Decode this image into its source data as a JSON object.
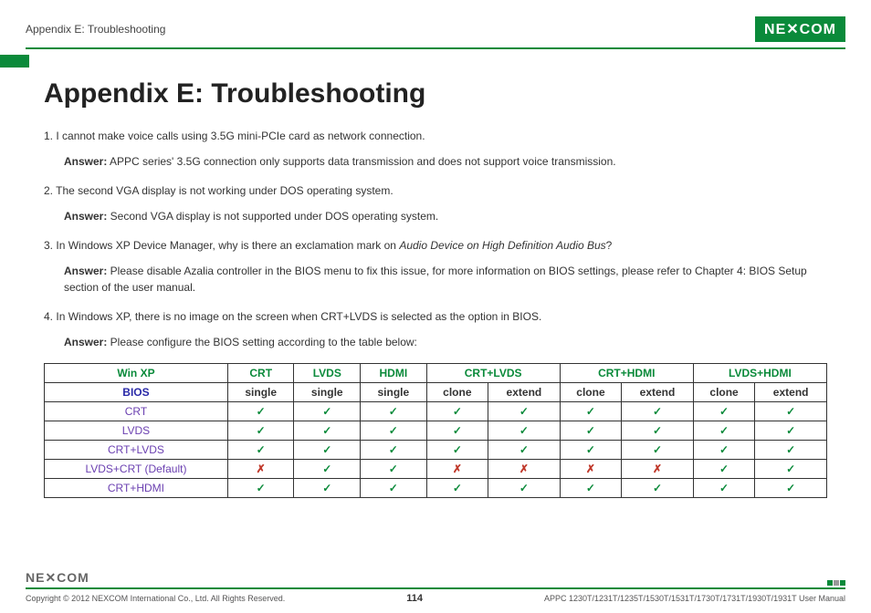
{
  "header": {
    "breadcrumb": "Appendix E: Troubleshooting",
    "logo_text": "NE✕COM"
  },
  "title": "Appendix E: Troubleshooting",
  "qa": [
    {
      "n": "1.",
      "q": "I cannot make voice calls using 3.5G mini-PCIe card as network connection.",
      "a_label": "Answer:",
      "a": " APPC series' 3.5G connection only supports data transmission and does not support voice transmission."
    },
    {
      "n": "2.",
      "q": "The second VGA display is not working under DOS operating system.",
      "a_label": "Answer:",
      "a": " Second VGA display is not supported under DOS operating system."
    },
    {
      "n": "3.",
      "q_pre": "In Windows XP Device Manager, why is there an exclamation mark on ",
      "q_em": "Audio Device on High Definition Audio Bus",
      "q_post": "?",
      "a_label": "Answer:",
      "a": " Please disable Azalia controller in the BIOS menu to fix this issue, for more information on BIOS settings, please refer to Chapter 4: BIOS Setup section of the user manual."
    },
    {
      "n": "4.",
      "q": "In Windows XP, there is no image on the screen when CRT+LVDS is selected as the option in BIOS.",
      "a_label": "Answer:",
      "a": " Please configure the BIOS setting according to the table below:"
    }
  ],
  "table": {
    "top_headers": [
      "Win XP",
      "CRT",
      "LVDS",
      "HDMI",
      "CRT+LVDS",
      "CRT+HDMI",
      "LVDS+HDMI"
    ],
    "sub_headers": [
      "BIOS",
      "single",
      "single",
      "single",
      "clone",
      "extend",
      "clone",
      "extend",
      "clone",
      "extend"
    ],
    "rows": [
      {
        "label": "CRT",
        "cells": [
          "y",
          "y",
          "y",
          "y",
          "y",
          "y",
          "y",
          "y",
          "y"
        ]
      },
      {
        "label": "LVDS",
        "cells": [
          "y",
          "y",
          "y",
          "y",
          "y",
          "y",
          "y",
          "y",
          "y"
        ]
      },
      {
        "label": "CRT+LVDS",
        "cells": [
          "y",
          "y",
          "y",
          "y",
          "y",
          "y",
          "y",
          "y",
          "y"
        ]
      },
      {
        "label": "LVDS+CRT (Default)",
        "cells": [
          "n",
          "y",
          "y",
          "n",
          "n",
          "n",
          "n",
          "y",
          "y"
        ]
      },
      {
        "label": "CRT+HDMI",
        "cells": [
          "y",
          "y",
          "y",
          "y",
          "y",
          "y",
          "y",
          "y",
          "y"
        ]
      }
    ],
    "check_glyph": "✓",
    "cross_glyph": "✗"
  },
  "footer": {
    "logo": "NE✕COM",
    "copyright": "Copyright © 2012 NEXCOM International Co., Ltd. All Rights Reserved.",
    "page": "114",
    "manual": "APPC 1230T/1231T/1235T/1530T/1531T/1730T/1731T/1930T/1931T User Manual"
  }
}
